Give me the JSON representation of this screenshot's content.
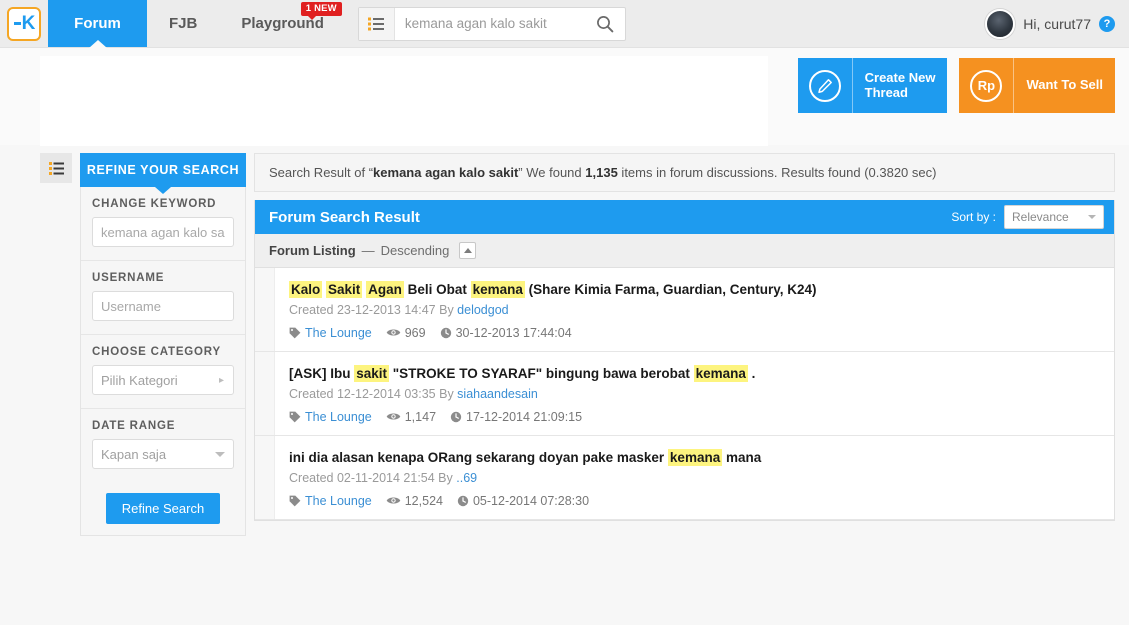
{
  "topnav": {
    "logo_alt": "kaskus-logo",
    "tabs": [
      {
        "label": "Forum",
        "active": true,
        "badge": null
      },
      {
        "label": "FJB",
        "active": false,
        "badge": null
      },
      {
        "label": "Playground",
        "active": false,
        "badge": "1 NEW"
      }
    ],
    "search": {
      "value": "kemana agan kalo sakit",
      "placeholder": "kemana agan kalo sakit",
      "list_icon": "list-icon",
      "search_icon": "search-icon"
    },
    "user": {
      "greeting": "Hi, curut77",
      "help_icon": "?"
    }
  },
  "actions": {
    "create_thread": {
      "label": "Create New Thread",
      "line1": "Create New",
      "line2": "Thread",
      "icon": "pencil-icon",
      "color": "#1e9bef"
    },
    "want_to_sell": {
      "label": "Want To Sell",
      "icon": "Rp",
      "color": "#f59120"
    }
  },
  "rail": {
    "toggle_icon": "list-toggle-icon"
  },
  "sidebar": {
    "header": "REFINE YOUR SEARCH",
    "groups": [
      {
        "label": "CHANGE KEYWORD",
        "type": "input",
        "value": "",
        "placeholder": "kemana agan kalo sakit"
      },
      {
        "label": "USERNAME",
        "type": "input",
        "value": "",
        "placeholder": "Username"
      },
      {
        "label": "CHOOSE CATEGORY",
        "type": "select-right",
        "value": "Pilih Kategori"
      },
      {
        "label": "DATE RANGE",
        "type": "select-down",
        "value": "Kapan saja"
      }
    ],
    "refine_button": "Refine Search"
  },
  "summary": {
    "prefix": "Search Result of “",
    "query": "kemana agan kalo sakit",
    "middle": "” We found ",
    "count": "1,135",
    "suffix": " items in forum discussions. Results found (0.3820 sec)"
  },
  "panel": {
    "title": "Forum Search Result",
    "sort_label": "Sort by :",
    "sort_value": "Relevance",
    "listing_label": "Forum Listing",
    "listing_sep": "—",
    "listing_order": "Descending"
  },
  "results": [
    {
      "title_parts": [
        {
          "t": "Kalo",
          "h": true
        },
        {
          "t": " "
        },
        {
          "t": "Sakit",
          "h": true
        },
        {
          "t": " "
        },
        {
          "t": "Agan",
          "h": true
        },
        {
          "t": " Beli Obat "
        },
        {
          "t": "kemana",
          "h": true
        },
        {
          "t": " (Share Kimia Farma, Guardian, Century, K24)"
        }
      ],
      "created_prefix": "Created 23-12-2013 14:47 By ",
      "author": "delodgod",
      "category": "The Lounge",
      "views": "969",
      "last_post": "30-12-2013 17:44:04"
    },
    {
      "title_parts": [
        {
          "t": "[ASK] Ibu "
        },
        {
          "t": "sakit",
          "h": true
        },
        {
          "t": " \"STROKE TO SYARAF\" bingung bawa berobat "
        },
        {
          "t": "kemana",
          "h": true
        },
        {
          "t": " ."
        }
      ],
      "created_prefix": "Created 12-12-2014 03:35 By ",
      "author": "siahaandesain",
      "category": "The Lounge",
      "views": "1,147",
      "last_post": "17-12-2014 21:09:15"
    },
    {
      "title_parts": [
        {
          "t": "ini dia alasan kenapa ORang sekarang doyan pake masker "
        },
        {
          "t": "kemana",
          "h": true
        },
        {
          "t": " mana"
        }
      ],
      "created_prefix": "Created 02-11-2014 21:54 By ",
      "author": "..69",
      "category": "The Lounge",
      "views": "12,524",
      "last_post": "05-12-2014 07:28:30"
    }
  ],
  "icons": {
    "tag": "tag-icon",
    "eye": "eye-icon",
    "clock": "clock-icon"
  },
  "colors": {
    "brand_blue": "#1e9bef",
    "brand_orange": "#f59120",
    "badge_red": "#e02020",
    "highlight": "#fdf47f",
    "link": "#3b8fd4"
  }
}
